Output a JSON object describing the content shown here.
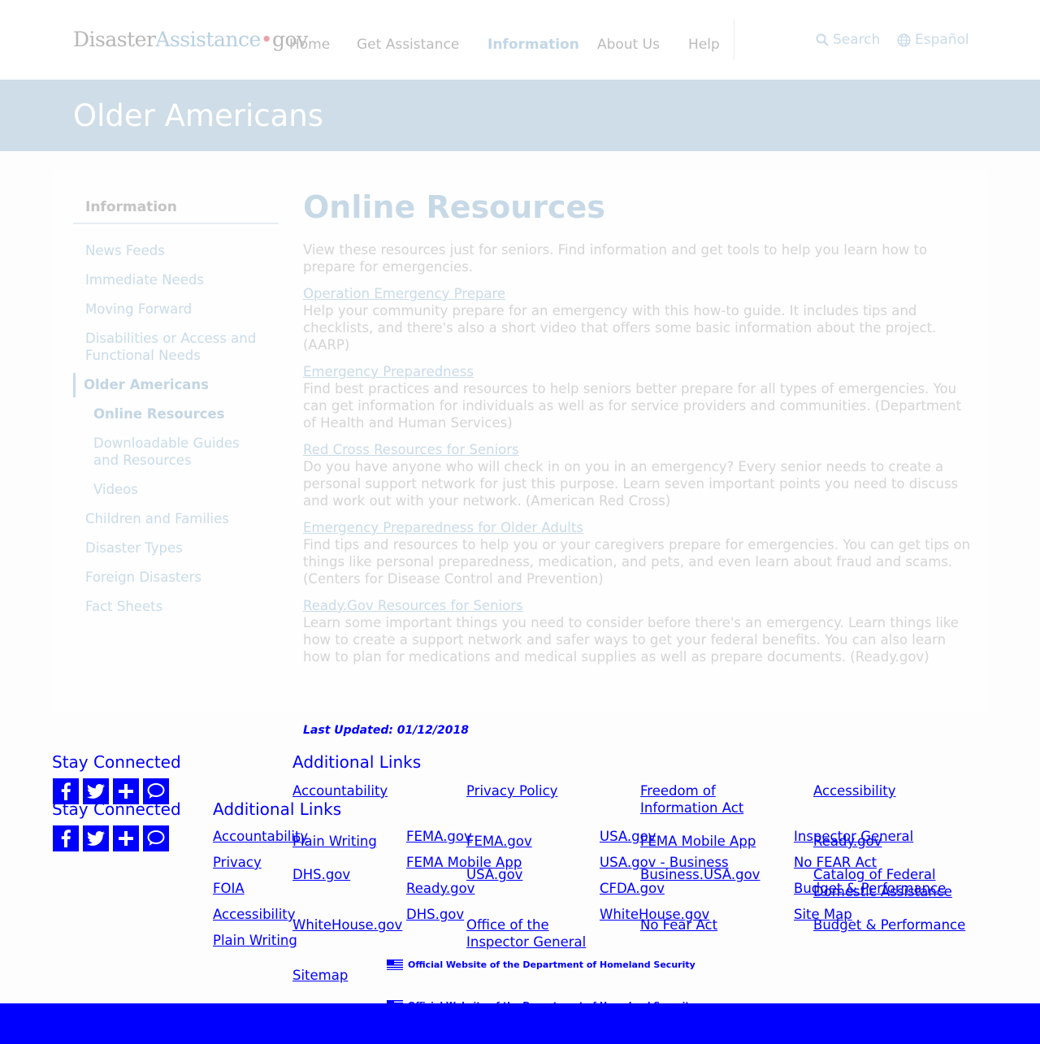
{
  "header": {
    "logo": {
      "part1": "Disaster",
      "part2": "Assistance",
      "dot": "•",
      "part3": "gov"
    },
    "nav": [
      "Home",
      "Get Assistance",
      "Information",
      "About Us",
      "Help"
    ],
    "search_label": "Search",
    "language_label": "Español"
  },
  "banner": {
    "title": "Older Americans"
  },
  "sidebar": {
    "heading": "Information",
    "items": [
      "News Feeds",
      "Immediate Needs",
      "Moving Forward",
      "Disabilities or Access and Functional Needs",
      "Older Americans"
    ],
    "subitems": [
      "Online Resources",
      "Downloadable Guides and Resources",
      "Videos"
    ],
    "items_after": [
      "Children and Families",
      "Disaster Types",
      "Foreign Disasters",
      "Fact Sheets"
    ]
  },
  "main": {
    "heading": "Online Resources",
    "intro": "View these resources just for seniors. Find information and get tools to help you learn how to prepare for emergencies.",
    "resources": [
      {
        "title": "Operation Emergency Prepare",
        "description": "Help your community prepare for an emergency with this how-to guide. It includes tips and checklists, and there's also a short video that offers some basic information about the project. (AARP)"
      },
      {
        "title": "Emergency Preparedness",
        "description": "Find best practices and resources to help seniors better prepare for all types of emergencies. You can get information for individuals as well as for service providers and communities. (Department of Health and Human Services)"
      },
      {
        "title": "Red Cross Resources for Seniors",
        "description": "Do you have anyone who will check in on you in an emergency? Every senior needs to create a personal support network for just this purpose. Learn seven important points you need to discuss and work out with your network. (American Red Cross)"
      },
      {
        "title": "Emergency Preparedness for Older Adults",
        "description": "Find tips and resources to help you or your caregivers prepare for emergencies. You can get tips on things like personal preparedness, medication, and pets, and even learn about fraud and scams. (Centers for Disease Control and Prevention)"
      },
      {
        "title": "Ready.Gov Resources for Seniors",
        "description": "Learn some important things you need to consider before there's an emergency. Learn things like how to create a support network and safer ways to get your federal benefits. You can also learn how to plan for medications and medical supplies as well as prepare documents. (Ready.gov)"
      }
    ],
    "last_updated": "Last Updated: 01/12/2018"
  },
  "footer": {
    "stay_connected": "Stay Connected",
    "additional_links": "Additional Links",
    "social": [
      "facebook-icon",
      "twitter-icon",
      "plus-icon",
      "chat-icon"
    ],
    "grid_a": {
      "col1": [
        "Accountability",
        "Plain Writing",
        "DHS.gov",
        "WhiteHouse.gov",
        "Sitemap"
      ],
      "col2": [
        "Privacy Policy",
        "FEMA.gov",
        "USA.gov",
        "Office of the Inspector General"
      ],
      "col3": [
        "Freedom of Information Act",
        "FEMA Mobile App",
        "Business.USA.gov",
        "No Fear Act"
      ],
      "col4": [
        "Accessibility",
        "Ready.gov",
        "Catalog of Federal Domestic Assistance",
        "Budget & Performance"
      ]
    },
    "grid_b": {
      "col1": [
        "Accountability",
        "Privacy",
        "FOIA",
        "Accessibility",
        "Plain Writing"
      ],
      "col2": [
        "FEMA.gov",
        "FEMA Mobile App",
        "Ready.gov",
        "DHS.gov"
      ],
      "col3": [
        "USA.gov",
        "USA.gov - Business",
        "CFDA.gov",
        "WhiteHouse.gov"
      ],
      "col4": [
        "Inspector General",
        "No FEAR Act",
        "Budget & Performance",
        "Site Map"
      ]
    },
    "official": "Official Website of the Department of Homeland Security"
  }
}
